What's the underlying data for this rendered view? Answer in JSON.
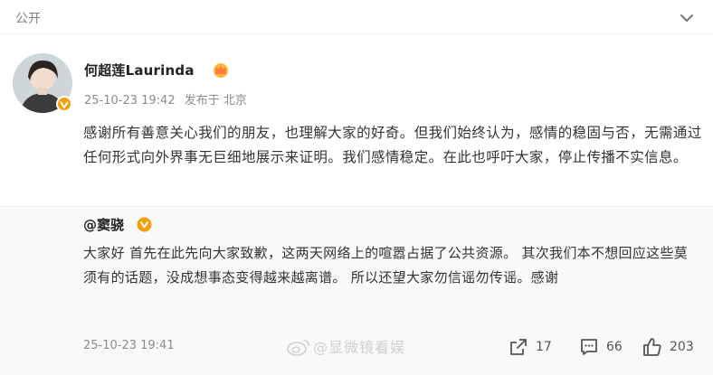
{
  "header": {
    "visibility": "公开"
  },
  "post": {
    "author": "何超莲Laurinda",
    "timestamp": "25-10-23 19:42",
    "source": "发布于 北京",
    "content": "感谢所有善意关心我们的朋友，也理解大家的好奇。但我们始终认为，感情的稳固与否，无需通过任何形式向外界事无巨细地展示来证明。我们感情稳定。在此也呼吁大家，停止传播不实信息。"
  },
  "repost": {
    "author": "@窦骁",
    "content": "大家好 首先在此先向大家致歉，这两天网络上的喧嚣占据了公共资源。 其次我们本不想回应这些莫须有的话题，没成想事态变得越来越离谱。 所以还望大家勿信谣勿传谣。感谢",
    "timestamp": "25-10-23 19:41",
    "stats": {
      "reposts": "17",
      "comments": "66",
      "likes": "203"
    }
  },
  "watermark": {
    "text": "@显微镜看娱"
  },
  "colors": {
    "verified_badge": "#f39e0a",
    "muted_text": "#8b8b8b",
    "repost_background": "#f9f9f9"
  },
  "icons": {
    "more": "chevron-down-icon",
    "verified": "verified-v-icon",
    "member": "crown-icon",
    "repost": "repost-icon",
    "comment": "comment-icon",
    "like": "thumbs-up-icon"
  }
}
